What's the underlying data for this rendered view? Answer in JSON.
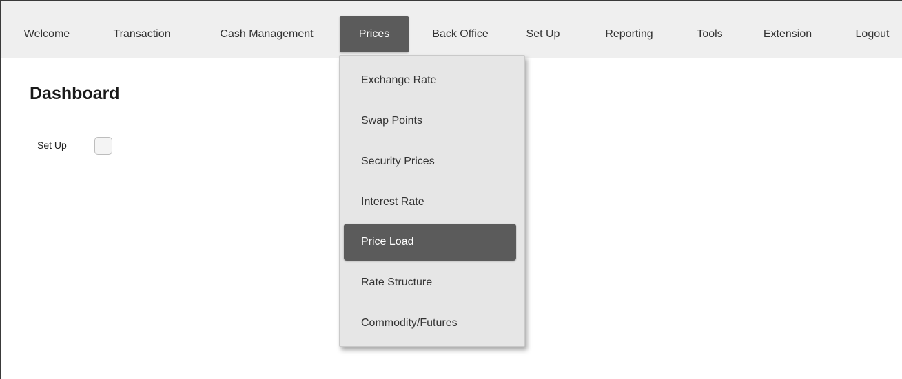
{
  "nav": {
    "items": [
      {
        "label": "Welcome"
      },
      {
        "label": "Transaction"
      },
      {
        "label": "Cash Management"
      },
      {
        "label": "Prices"
      },
      {
        "label": "Back Office"
      },
      {
        "label": "Set Up"
      },
      {
        "label": "Reporting"
      },
      {
        "label": "Tools"
      },
      {
        "label": "Extension"
      },
      {
        "label": "Logout"
      }
    ],
    "active": "Prices"
  },
  "dashboard": {
    "title": "Dashboard",
    "setup_label": "Set Up",
    "setup_checked": false
  },
  "prices_menu": {
    "items": [
      {
        "label": "Exchange Rate"
      },
      {
        "label": "Swap Points"
      },
      {
        "label": "Security Prices"
      },
      {
        "label": "Interest Rate"
      },
      {
        "label": "Price Load"
      },
      {
        "label": "Rate Structure"
      },
      {
        "label": "Commodity/Futures"
      }
    ],
    "highlighted": "Price Load"
  },
  "colors": {
    "navbar_bg": "#efefef",
    "active_bg": "#5b5b5b",
    "dropdown_bg": "#e6e6e6",
    "text": "#333333"
  }
}
